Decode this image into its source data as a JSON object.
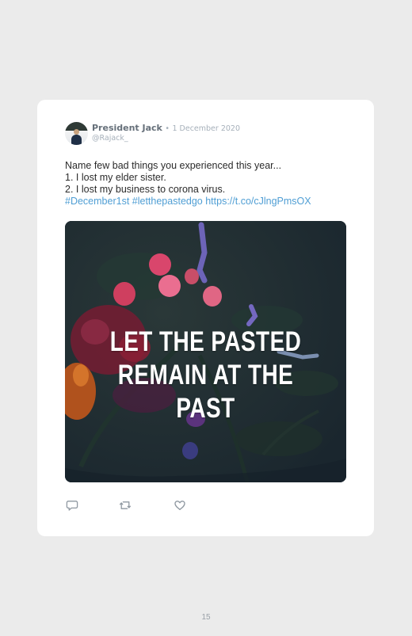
{
  "tweet": {
    "display_name": "President Jack",
    "separator": "•",
    "date": "1 December 2020",
    "handle": "@Rajack_",
    "text_lines": [
      "Name few bad things you experienced this year...",
      "1. I lost my elder sister.",
      "2. I lost my business to corona virus."
    ],
    "hashtag_1": "#December1st",
    "hashtag_2": "#letthepastedgo",
    "url": "https://t.co/cJlngPmsOX",
    "media_text_lines": [
      "LET THE PASTED",
      "REMAIN AT THE PAST"
    ]
  },
  "actions": {
    "reply_icon": "reply-icon",
    "retweet_icon": "retweet-icon",
    "like_icon": "heart-icon"
  },
  "page": {
    "number": "15"
  },
  "colors": {
    "background": "#ebebeb",
    "card": "#ffffff",
    "link": "#4f9ed4",
    "muted": "#a6b0ba",
    "name": "#66707a",
    "media_dark": "#1a262e"
  }
}
